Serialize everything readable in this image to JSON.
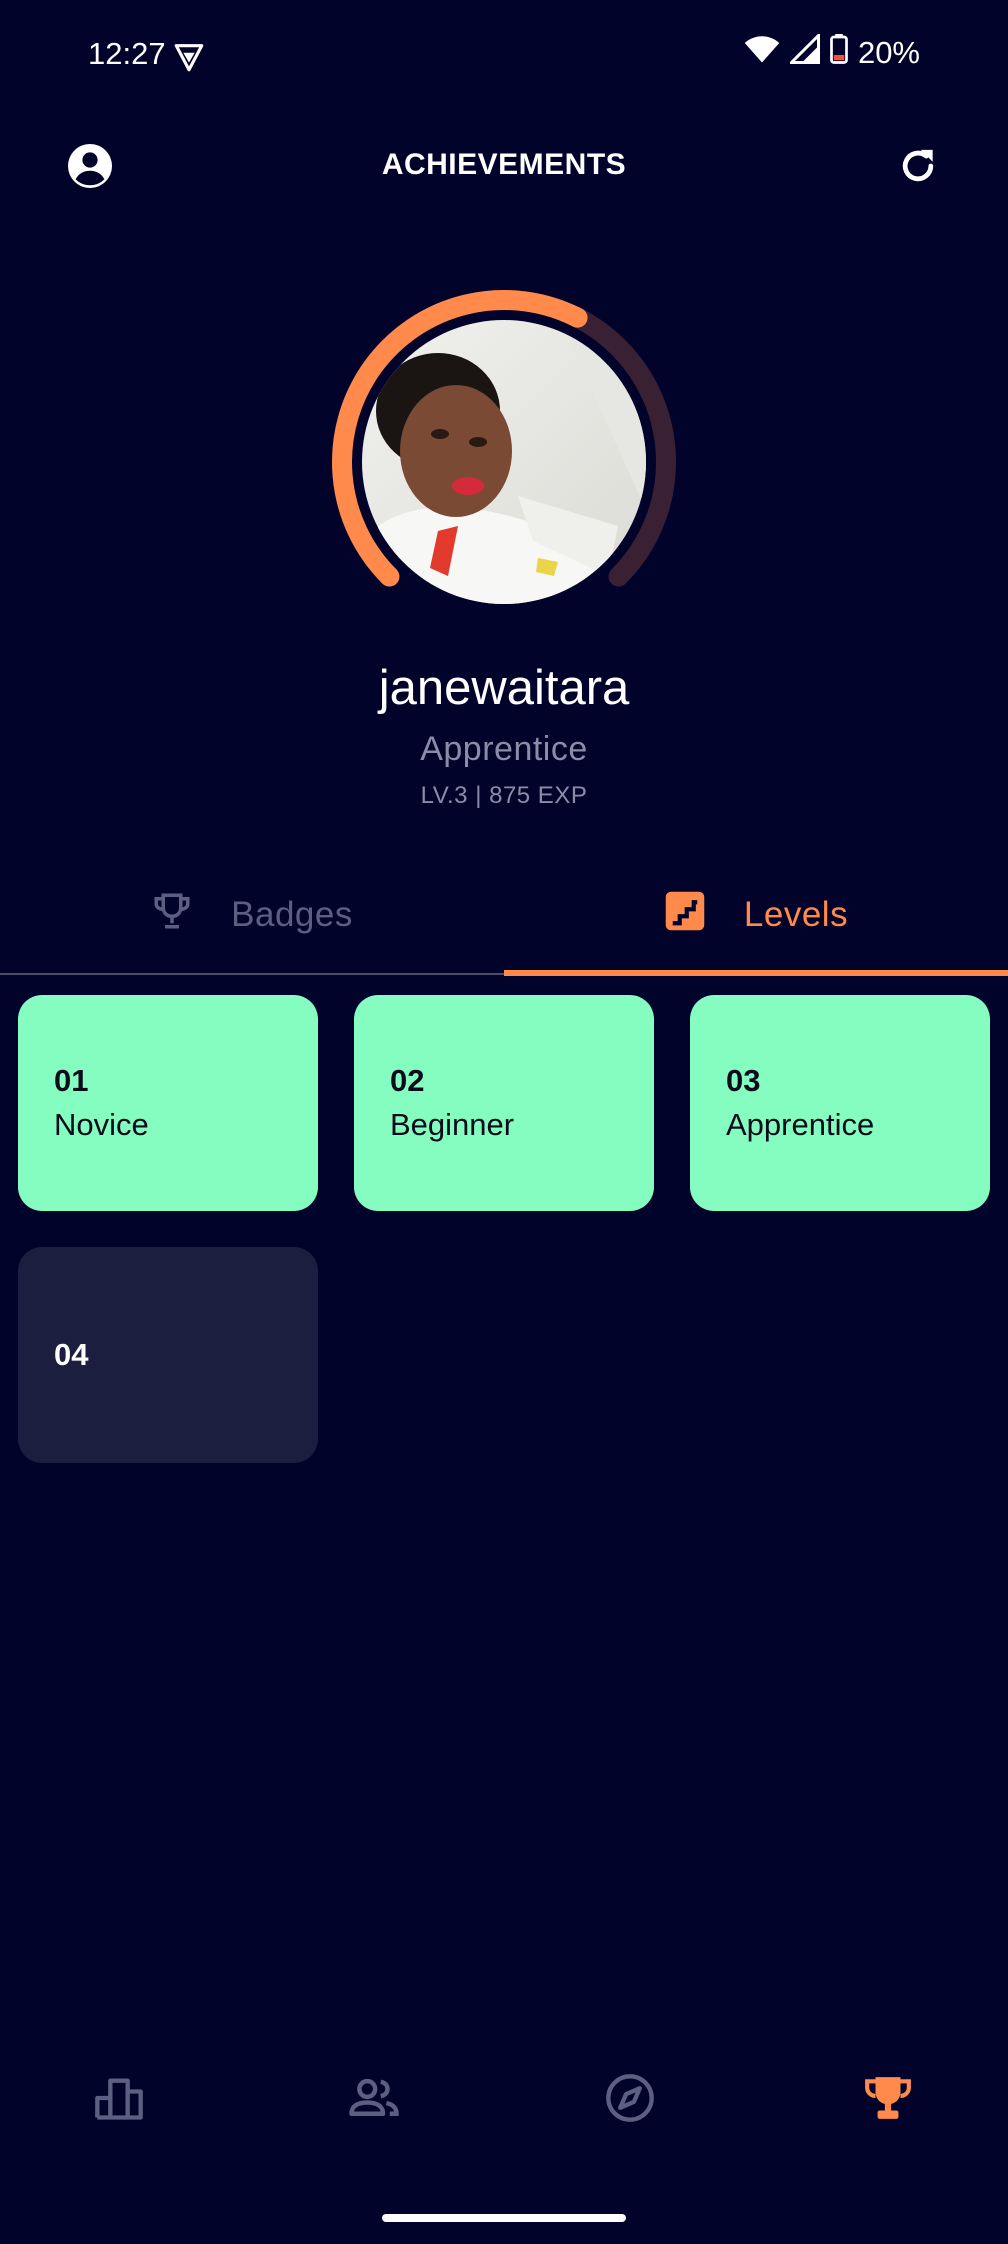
{
  "status_bar": {
    "time": "12:27",
    "battery": "20%"
  },
  "header": {
    "title": "ACHIEVEMENTS"
  },
  "profile": {
    "username": "janewaitara",
    "rank": "Apprentice",
    "level_info": "LV.3 | 875 EXP",
    "level_progress": 0.6
  },
  "tabs": [
    {
      "label": "Badges",
      "icon": "trophy-icon",
      "active": false
    },
    {
      "label": "Levels",
      "icon": "stairs-icon",
      "active": true
    }
  ],
  "levels": [
    {
      "number": "01",
      "name": "Novice",
      "unlocked": true
    },
    {
      "number": "02",
      "name": "Beginner",
      "unlocked": true
    },
    {
      "number": "03",
      "name": "Apprentice",
      "unlocked": true
    },
    {
      "number": "04",
      "name": "",
      "unlocked": false
    }
  ],
  "bottom_nav": [
    {
      "icon": "leaderboard-icon",
      "active": false
    },
    {
      "icon": "people-icon",
      "active": false
    },
    {
      "icon": "compass-icon",
      "active": false
    },
    {
      "icon": "trophy-icon",
      "active": true
    }
  ],
  "colors": {
    "background": "#02032b",
    "accent": "#ff8a4c",
    "unlocked_card": "#85fdc1",
    "locked_card": "#1c1e3f",
    "muted_text": "#8a8ca8"
  }
}
